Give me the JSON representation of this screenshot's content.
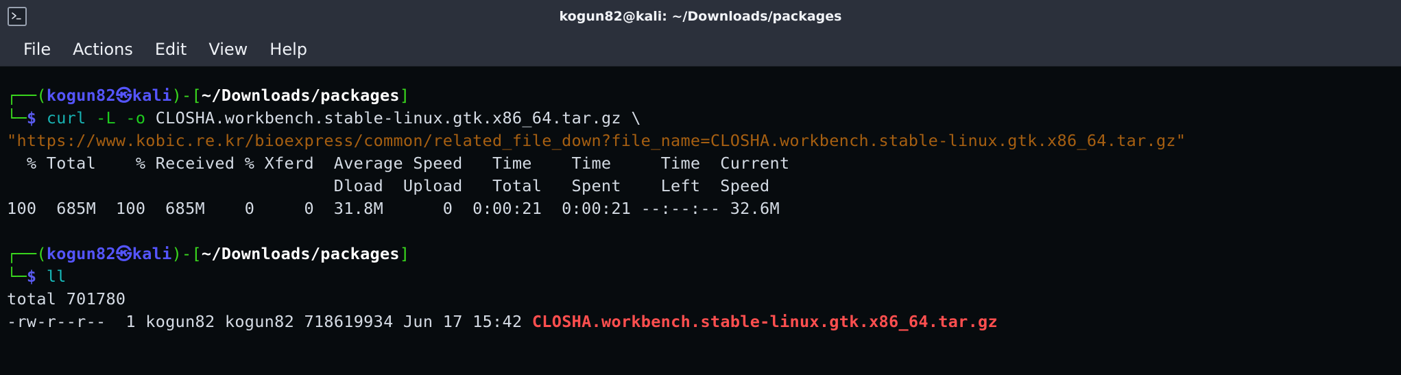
{
  "window": {
    "title": "kogun82@kali: ~/Downloads/packages",
    "icon": "terminal-icon"
  },
  "menubar": {
    "items": [
      {
        "label": "File"
      },
      {
        "label": "Actions"
      },
      {
        "label": "Edit"
      },
      {
        "label": "View"
      },
      {
        "label": "Help"
      }
    ]
  },
  "terminal": {
    "prompt": {
      "corner_top": "┌──",
      "corner_bottom": "└─",
      "paren_open": "(",
      "user": "kogun82",
      "at": "㉿",
      "host": "kali",
      "paren_close": ")",
      "dash": "-",
      "bracket_open": "[",
      "cwd": "~/Downloads/packages",
      "bracket_close": "]",
      "dollar": "$"
    },
    "block1": {
      "command_name": "curl",
      "option_l": "-L",
      "option_o": "-o",
      "output_filename": "CLOSHA.workbench.stable-linux.gtk.x86_64.tar.gz",
      "continuation": "\\",
      "url": "\"https://www.kobic.re.kr/bioexpress/common/related_file_down?file_name=CLOSHA.workbench.stable-linux.gtk.x86_64.tar.gz\"",
      "progress_header_line1": "  % Total    % Received % Xferd  Average Speed   Time    Time     Time  Current",
      "progress_header_line2": "                                 Dload  Upload   Total   Spent    Left  Speed",
      "progress_row": "100  685M  100  685M    0     0  31.8M      0  0:00:21  0:00:21 --:--:-- 32.6M"
    },
    "block2": {
      "command_name": "ll",
      "total_line": "total 701780",
      "listing": {
        "permissions": "-rw-r--r--",
        "links": "1",
        "owner": "kogun82",
        "group": "kogun82",
        "size": "718619934",
        "month": "Jun",
        "day": "17",
        "time": "15:42",
        "filename": "CLOSHA.workbench.stable-linux.gtk.x86_64.tar.gz"
      }
    }
  },
  "colors": {
    "titlebar_bg": "#2b303b",
    "terminal_bg": "#070b0e",
    "prompt_green": "#3ad91e",
    "prompt_blue": "#5555ff",
    "cwd_white": "#ffffff",
    "command_cyan": "#18b2b2",
    "option_green": "#1ecb1e",
    "url_orange": "#a65f11",
    "archive_red": "#ff4f4f",
    "text_default": "#d4dbe4"
  }
}
